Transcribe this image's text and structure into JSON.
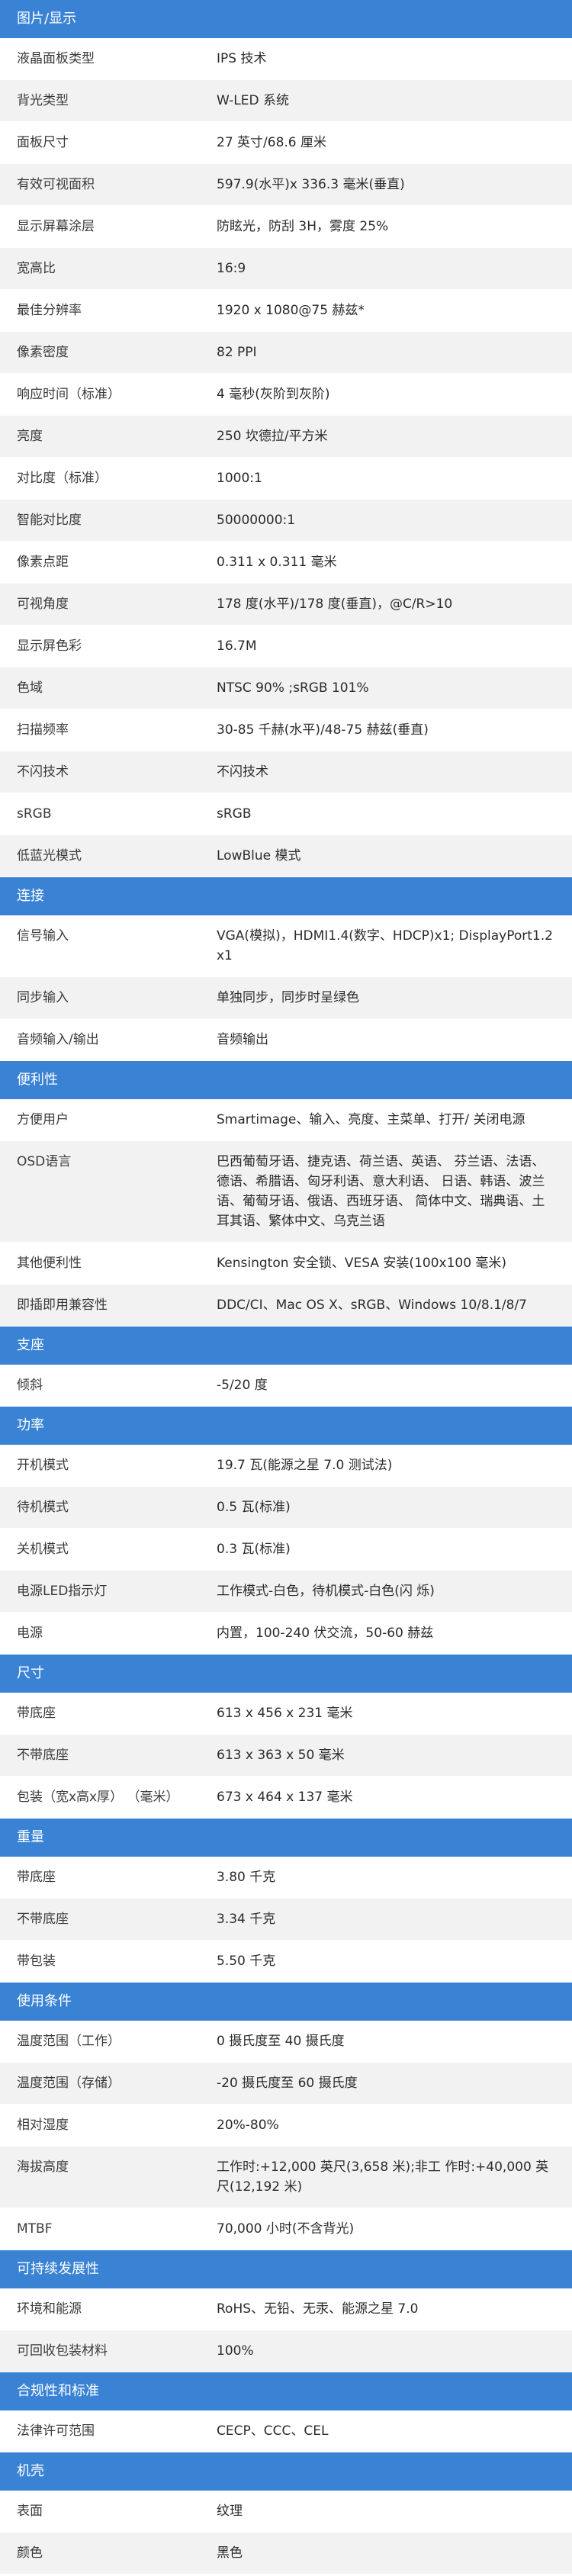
{
  "sections": [
    {
      "title": "图片/显示",
      "rows": [
        {
          "label": "液晶面板类型",
          "value": "IPS 技术"
        },
        {
          "label": "背光类型",
          "value": "W-LED 系统"
        },
        {
          "label": "面板尺寸",
          "value": "27 英寸/68.6 厘米"
        },
        {
          "label": "有效可视面积",
          "value": "597.9(水平)x 336.3 毫米(垂直)"
        },
        {
          "label": "显示屏幕涂层",
          "value": "防眩光，防刮 3H，雾度 25%"
        },
        {
          "label": "宽高比",
          "value": "16:9"
        },
        {
          "label": "最佳分辨率",
          "value": "1920 x 1080@75 赫兹*"
        },
        {
          "label": "像素密度",
          "value": "82 PPI"
        },
        {
          "label": "响应时间（标准）",
          "value": "4 毫秒(灰阶到灰阶)"
        },
        {
          "label": "亮度",
          "value": "250 坎德拉/平方米"
        },
        {
          "label": "对比度（标准）",
          "value": "1000:1"
        },
        {
          "label": "智能对比度",
          "value": "50000000:1"
        },
        {
          "label": "像素点距",
          "value": "0.311 x 0.311 毫米"
        },
        {
          "label": "可视角度",
          "value": "178 度(水平)/178 度(垂直)，@C/R>10"
        },
        {
          "label": "显示屏色彩",
          "value": "16.7M"
        },
        {
          "label": "色域",
          "value": "NTSC 90% ;sRGB 101%"
        },
        {
          "label": "扫描频率",
          "value": "30-85 千赫(水平)/48-75 赫兹(垂直)"
        },
        {
          "label": "不闪技术",
          "value": "不闪技术"
        },
        {
          "label": "sRGB",
          "value": "sRGB"
        },
        {
          "label": "低蓝光模式",
          "value": "LowBlue 模式"
        }
      ]
    },
    {
      "title": "连接",
      "rows": [
        {
          "label": "信号输入",
          "value": "VGA(模拟)，HDMI1.4(数字、HDCP)x1; DisplayPort1.2x1"
        },
        {
          "label": "同步输入",
          "value": "单独同步，同步时呈绿色"
        },
        {
          "label": "音频输入/输出",
          "value": "音频输出"
        }
      ]
    },
    {
      "title": "便利性",
      "rows": [
        {
          "label": "方便用户",
          "value": "Smartimage、输入、亮度、主菜单、打开/ 关闭电源"
        },
        {
          "label": "OSD语言",
          "value": "巴西葡萄牙语、捷克语、荷兰语、英语、 芬兰语、法语、德语、希腊语、匈牙利语、意大利语、 日语、韩语、波兰语、葡萄牙语、俄语、西班牙语、 简体中文、瑞典语、土耳其语、繁体中文、乌克兰语"
        },
        {
          "label": "其他便利性",
          "value": "Kensington 安全锁、VESA 安装(100x100 毫米)"
        },
        {
          "label": "即插即用兼容性",
          "value": "DDC/CI、Mac OS X、sRGB、Windows 10/8.1/8/7"
        }
      ]
    },
    {
      "title": "支座",
      "rows": [
        {
          "label": "倾斜",
          "value": "-5/20 度"
        }
      ]
    },
    {
      "title": "功率",
      "rows": [
        {
          "label": "开机模式",
          "value": "19.7 瓦(能源之星 7.0 测试法)"
        },
        {
          "label": "待机模式",
          "value": "0.5 瓦(标准)"
        },
        {
          "label": "关机模式",
          "value": "0.3 瓦(标准)"
        },
        {
          "label": "电源LED指示灯",
          "value": "工作模式-白色，待机模式-白色(闪 烁)"
        },
        {
          "label": "电源",
          "value": "内置，100-240 伏交流，50-60 赫兹"
        }
      ]
    },
    {
      "title": "尺寸",
      "rows": [
        {
          "label": "带底座",
          "value": "613 x 456 x 231 毫米"
        },
        {
          "label": "不带底座",
          "value": "613 x 363 x 50 毫米"
        },
        {
          "label": "包装（宽x高x厚） （毫米）",
          "value": "673 x 464 x 137 毫米"
        }
      ]
    },
    {
      "title": "重量",
      "rows": [
        {
          "label": "带底座",
          "value": "3.80 千克"
        },
        {
          "label": "不带底座",
          "value": "3.34 千克"
        },
        {
          "label": "带包装",
          "value": "5.50 千克"
        }
      ]
    },
    {
      "title": "使用条件",
      "rows": [
        {
          "label": "温度范围（工作）",
          "value": "0 摄氏度至 40 摄氏度"
        },
        {
          "label": "温度范围（存储）",
          "value": "-20 摄氏度至 60 摄氏度"
        },
        {
          "label": "相对湿度",
          "value": "20%-80%"
        },
        {
          "label": "海拔高度",
          "value": "工作时:+12,000 英尺(3,658 米);非工 作时:+40,000 英尺(12,192 米)"
        },
        {
          "label": "MTBF",
          "value": "70,000 小时(不含背光)"
        }
      ]
    },
    {
      "title": "可持续发展性",
      "rows": [
        {
          "label": "环境和能源",
          "value": "RoHS、无铅、无汞、能源之星 7.0"
        },
        {
          "label": "可回收包装材料",
          "value": "100%"
        }
      ]
    },
    {
      "title": "合规性和标准",
      "rows": [
        {
          "label": "法律许可范围",
          "value": "CECP、CCC、CEL"
        }
      ]
    },
    {
      "title": "机壳",
      "rows": [
        {
          "label": "表面",
          "value": "纹理"
        },
        {
          "label": "颜色",
          "value": "黑色"
        }
      ]
    }
  ]
}
